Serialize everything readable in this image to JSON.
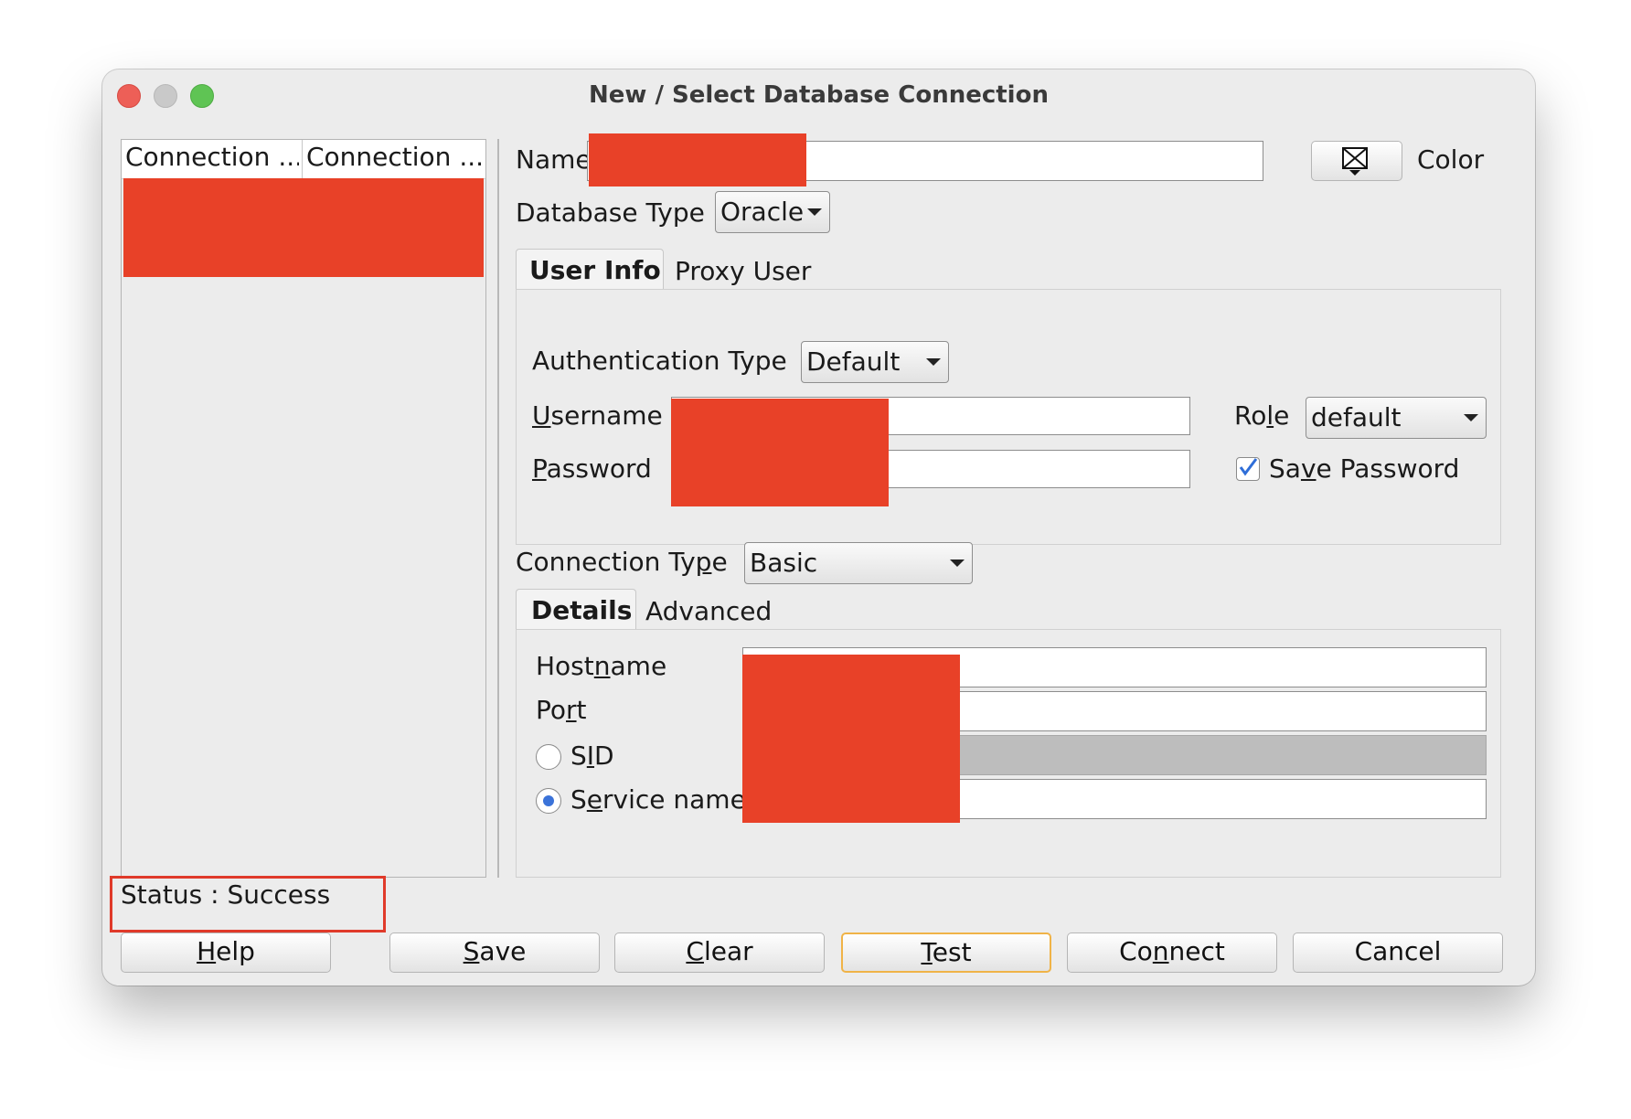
{
  "window": {
    "title": "New / Select Database Connection"
  },
  "connections_list": {
    "columns": [
      "Connection ...",
      "Connection ..."
    ]
  },
  "form": {
    "name_label": "Name",
    "color_label": "Color",
    "database_type_label": "Database Type",
    "database_type_value": "Oracle",
    "tabs": [
      "User Info",
      "Proxy User"
    ],
    "auth_type_label": "Authentication Type",
    "auth_type_value": "Default",
    "username_label": {
      "m": "U",
      "rest": "sername"
    },
    "password_label": {
      "m": "P",
      "rest": "assword"
    },
    "role_label": {
      "pre": "Ro",
      "m": "l",
      "post": "e"
    },
    "role_value": "default",
    "save_password_label": {
      "pre": "Sa",
      "m": "v",
      "post": "e Password"
    },
    "save_password_checked": true,
    "connection_type_label": {
      "pre": "Connection Ty",
      "m": "p",
      "post": "e"
    },
    "connection_type_value": "Basic",
    "detail_tabs": [
      "Details",
      "Advanced"
    ],
    "hostname_label": {
      "pre": "Host",
      "m": "n",
      "post": "ame"
    },
    "port_label": {
      "pre": "Po",
      "m": "r",
      "post": "t"
    },
    "sid_label": {
      "pre": "S",
      "m": "I",
      "post": "D"
    },
    "service_name_label": {
      "pre": "S",
      "m": "e",
      "post": "rvice name"
    },
    "selected_radio": "Service name"
  },
  "status": {
    "text": "Status : Success",
    "highlight_color": "#e03a2a"
  },
  "buttons": [
    {
      "m": "H",
      "rest": "elp"
    },
    {
      "m": "S",
      "rest": "ave"
    },
    {
      "m": "C",
      "rest": "lear"
    },
    {
      "m": "T",
      "rest": "est"
    },
    {
      "pre": "Co",
      "m": "n",
      "post": "nect"
    },
    {
      "pre": "",
      "m": "",
      "post": "Cancel"
    }
  ],
  "colors": {
    "redaction": "#e84128",
    "default_button_border": "#f0b347",
    "close": "#ed5f57",
    "minimize": "#c8c8c8",
    "zoom": "#5fc454"
  }
}
